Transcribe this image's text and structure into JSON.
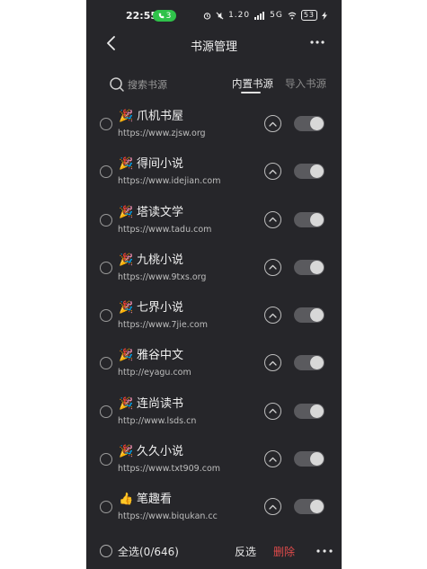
{
  "status_bar": {
    "time": "22:55",
    "call_badge": "3",
    "net_speed": "1.20",
    "signal_text": "5G",
    "battery": "53"
  },
  "nav": {
    "title": "书源管理"
  },
  "search": {
    "placeholder": "搜索书源"
  },
  "tabs": [
    {
      "label": "内置书源",
      "active": true
    },
    {
      "label": "导入书源",
      "active": false
    }
  ],
  "sources": [
    {
      "icon": "party-popper-icon",
      "emoji": "🎉",
      "name": "爪机书屋",
      "url": "https://www.zjsw.org",
      "enabled": true
    },
    {
      "icon": "party-popper-icon",
      "emoji": "🎉",
      "name": "得间小说",
      "url": "https://www.idejian.com",
      "enabled": true
    },
    {
      "icon": "party-popper-icon",
      "emoji": "🎉",
      "name": "塔读文学",
      "url": "https://www.tadu.com",
      "enabled": true
    },
    {
      "icon": "party-popper-icon",
      "emoji": "🎉",
      "name": "九桃小说",
      "url": "https://www.9txs.org",
      "enabled": true
    },
    {
      "icon": "party-popper-icon",
      "emoji": "🎉",
      "name": "七界小说",
      "url": "https://www.7jie.com",
      "enabled": true
    },
    {
      "icon": "party-popper-icon",
      "emoji": "🎉",
      "name": "雅谷中文",
      "url": "http://eyagu.com",
      "enabled": true
    },
    {
      "icon": "party-popper-icon",
      "emoji": "🎉",
      "name": "连尚读书",
      "url": "http://www.lsds.cn",
      "enabled": true
    },
    {
      "icon": "party-popper-icon",
      "emoji": "🎉",
      "name": "久久小说",
      "url": "https://www.txt909.com",
      "enabled": true
    },
    {
      "icon": "thumbs-up-icon",
      "emoji": "👍",
      "name": "笔趣看",
      "url": "https://www.biqukan.cc",
      "enabled": true
    }
  ],
  "bottom_bar": {
    "select_all": "全选(0/646)",
    "invert": "反选",
    "delete": "删除"
  },
  "colors": {
    "background": "#26262a",
    "delete": "#e04b4b",
    "call_badge": "#2fc24a"
  }
}
